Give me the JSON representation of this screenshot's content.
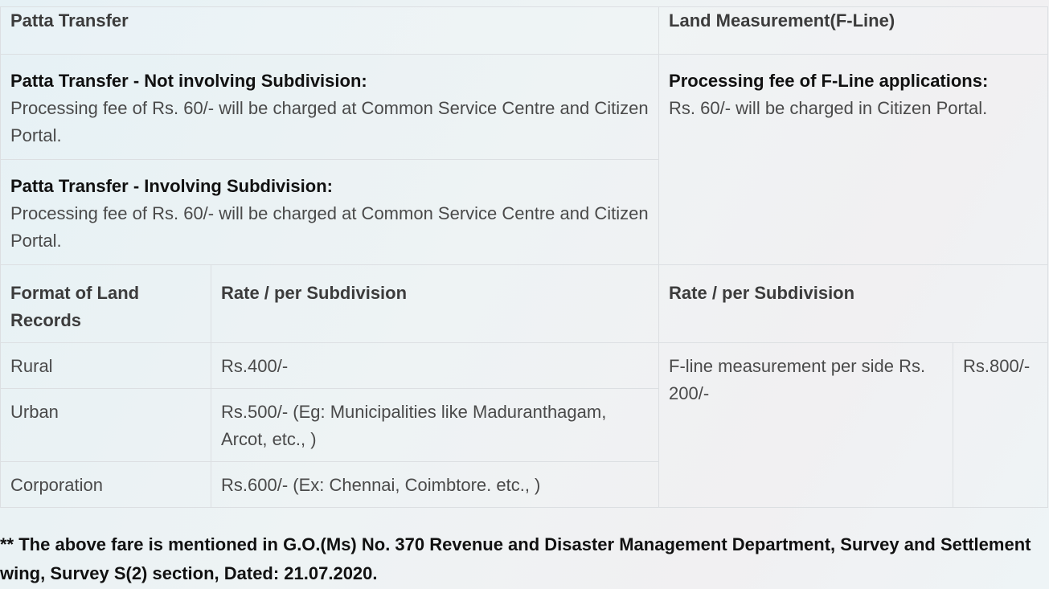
{
  "header": {
    "left": "Patta Transfer",
    "right": "Land Measurement(F-Line)"
  },
  "patta": {
    "not_involving": {
      "title": "Patta Transfer - Not involving Subdivision:",
      "text": "Processing fee of Rs. 60/- will be charged at Common Service Centre and Citizen Portal."
    },
    "involving": {
      "title": "Patta Transfer - Involving Subdivision:",
      "text": "Processing fee of Rs. 60/- will be charged at Common Service Centre and Citizen Portal."
    }
  },
  "fline": {
    "title": "Processing fee of F-Line applications:",
    "text": "Rs. 60/- will be charged in Citizen Portal."
  },
  "subheader": {
    "format": "Format of Land Records",
    "rate_left": "Rate / per Subdivision",
    "rate_right": "Rate / per Subdivision"
  },
  "rows": [
    {
      "format": "Rural",
      "rate": "Rs.400/-"
    },
    {
      "format": "Urban",
      "rate": "Rs.500/- (Eg: Municipalities like Maduranthagam, Arcot, etc., )"
    },
    {
      "format": "Corporation",
      "rate": "Rs.600/- (Ex: Chennai, Coimbtore. etc., )"
    }
  ],
  "fline_rates": {
    "measurement": "F-line measurement per side Rs. 200/-",
    "amount": "Rs.800/-"
  },
  "footnote": "** The above fare is mentioned in G.O.(Ms) No. 370 Revenue and Disaster Management Department, Survey and Settlement wing, Survey S(2) section, Dated: 21.07.2020."
}
